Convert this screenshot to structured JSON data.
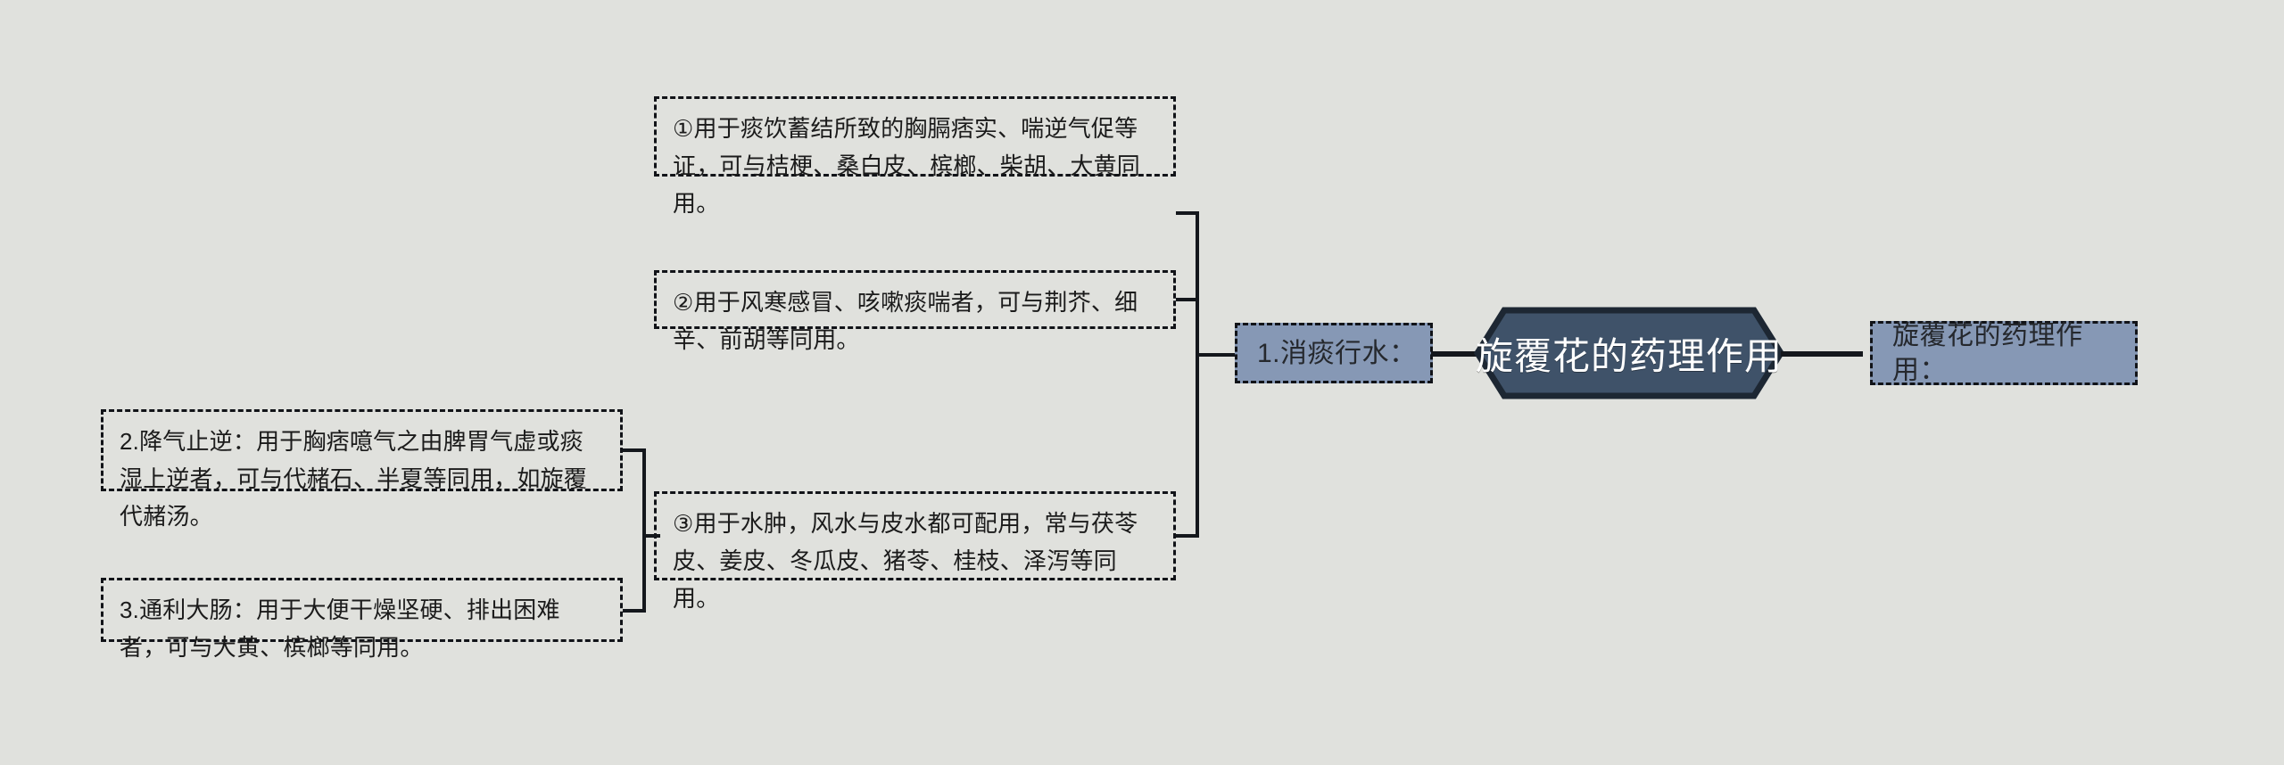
{
  "diagram": {
    "type": "mind-map",
    "background_color": "#e0e1dd",
    "accent_dark": "#3f5269",
    "accent_light": "#8698b5",
    "line_color": "#14171c",
    "center": {
      "label": "旋覆花的药理作用"
    },
    "right_node": {
      "label": "旋覆花的药理作用："
    },
    "branches": [
      {
        "id": "branch-1",
        "label": "1.消痰行水：",
        "children": [
          {
            "id": "leaf-1-1",
            "text": "①用于痰饮蓄结所致的胸膈痞实、喘逆气促等证，可与桔梗、桑白皮、槟榔、柴胡、大黄同用。"
          },
          {
            "id": "leaf-1-2",
            "text": "②用于风寒感冒、咳嗽痰喘者，可与荆芥、细辛、前胡等同用。"
          },
          {
            "id": "leaf-1-3",
            "text": "③用于水肿，风水与皮水都可配用，常与茯苓皮、姜皮、冬瓜皮、猪苓、桂枝、泽泻等同用。"
          }
        ]
      },
      {
        "id": "branch-2",
        "text": "2.降气止逆：用于胸痞噫气之由脾胃气虚或痰湿上逆者，可与代赭石、半夏等同用，如旋覆代赭汤。"
      },
      {
        "id": "branch-3",
        "text": "3.通利大肠：用于大便干燥坚硬、排出困难者，可与大黄、槟榔等同用。"
      }
    ]
  }
}
